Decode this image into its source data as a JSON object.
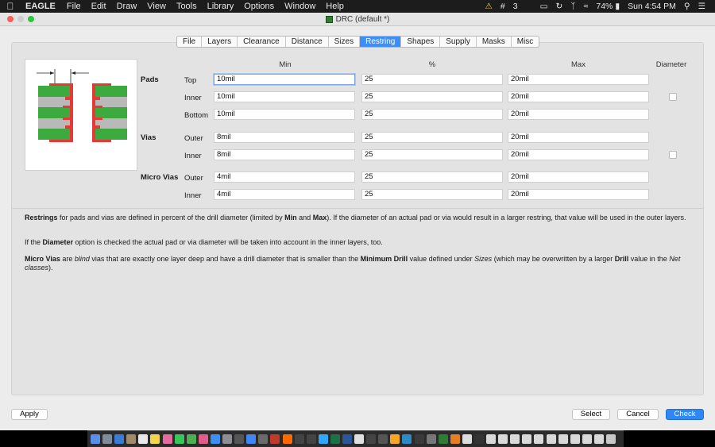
{
  "menubar": {
    "app_name": "EAGLE",
    "menus": [
      "File",
      "Edit",
      "Draw",
      "View",
      "Tools",
      "Library",
      "Options",
      "Window",
      "Help"
    ],
    "notification_count": "3",
    "battery": "74%",
    "clock": "Sun 4:54 PM"
  },
  "window": {
    "title": "DRC (default *)"
  },
  "tabs": [
    "File",
    "Layers",
    "Clearance",
    "Distance",
    "Sizes",
    "Restring",
    "Shapes",
    "Supply",
    "Masks",
    "Misc"
  ],
  "active_tab": "Restring",
  "columns": {
    "min": "Min",
    "percent": "%",
    "max": "Max",
    "diameter": "Diameter"
  },
  "groups": {
    "pads": {
      "label": "Pads",
      "rows": [
        {
          "label": "Top",
          "min": "10mil",
          "percent": "25",
          "max": "20mil"
        },
        {
          "label": "Inner",
          "min": "10mil",
          "percent": "25",
          "max": "20mil"
        },
        {
          "label": "Bottom",
          "min": "10mil",
          "percent": "25",
          "max": "20mil"
        }
      ]
    },
    "vias": {
      "label": "Vias",
      "rows": [
        {
          "label": "Outer",
          "min": "8mil",
          "percent": "25",
          "max": "20mil"
        },
        {
          "label": "Inner",
          "min": "8mil",
          "percent": "25",
          "max": "20mil"
        }
      ]
    },
    "micro_vias": {
      "label": "Micro Vias",
      "rows": [
        {
          "label": "Outer",
          "min": "4mil",
          "percent": "25",
          "max": "20mil"
        },
        {
          "label": "Inner",
          "min": "4mil",
          "percent": "25",
          "max": "20mil"
        }
      ]
    }
  },
  "description": {
    "p1": {
      "b1": "Restrings",
      "t1": " for pads and vias are defined in percent of the drill diameter (limited by ",
      "b2": "Min",
      "t2": " and ",
      "b3": "Max",
      "t3": "). If the diameter of an actual pad or via would result in a larger restring, that value will be used in the outer layers."
    },
    "p2": {
      "t1": "If the ",
      "b1": "Diameter",
      "t2": " option is checked the actual pad or via diameter will be taken into account in the inner layers, too."
    },
    "p3": {
      "b1": "Micro Vias",
      "t1": " are ",
      "i1": "blind",
      "t2": " vias that are exactly one layer deep and have a drill diameter that is smaller than the ",
      "b2": "Minimum Drill",
      "t3": " value defined under ",
      "i2": "Sizes",
      "t4": " (which may be overwritten by a larger ",
      "b3": "Drill",
      "t5": " value in the ",
      "i3": "Net classes",
      "t6": ")."
    }
  },
  "buttons": {
    "apply": "Apply",
    "select": "Select",
    "cancel": "Cancel",
    "check": "Check"
  },
  "colors": {
    "accent": "#2f86f5",
    "pcb_green": "#3daa3f",
    "copper_red": "#e53935"
  }
}
